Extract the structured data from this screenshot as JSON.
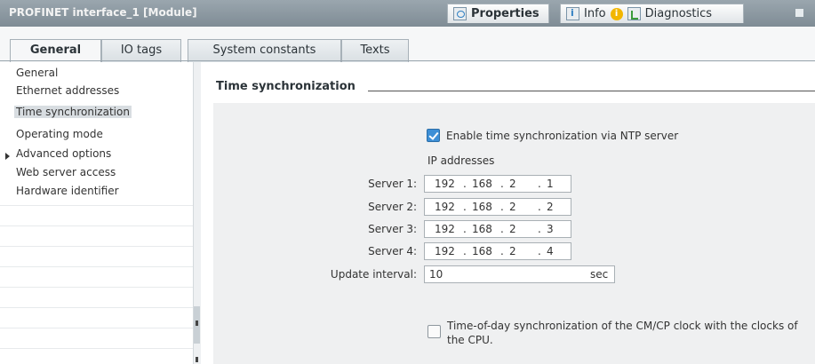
{
  "header": {
    "title": "PROFINET interface_1 [Module]",
    "tabs": [
      {
        "label": "Properties",
        "icon": "properties-icon"
      },
      {
        "label": "Info",
        "icon": "info-icon"
      },
      {
        "label": "Diagnostics",
        "icon": "diagnostics-icon"
      }
    ],
    "warning_badge": "i"
  },
  "subtabs": [
    "General",
    "IO tags",
    "System constants",
    "Texts"
  ],
  "sidebar": {
    "items": [
      {
        "label": "General"
      },
      {
        "label": "Ethernet addresses"
      },
      {
        "label": "Time synchronization",
        "selected": true
      },
      {
        "label": "Operating mode"
      },
      {
        "label": "Advanced options",
        "expandable": true
      },
      {
        "label": "Web server access"
      },
      {
        "label": "Hardware identifier"
      }
    ]
  },
  "main": {
    "section_title": "Time synchronization",
    "enable_ntp": {
      "label": "Enable time synchronization via NTP server",
      "checked": true
    },
    "ip_heading": "IP addresses",
    "servers": [
      {
        "label": "Server 1:",
        "octets": [
          "192",
          "168",
          "2",
          "1"
        ]
      },
      {
        "label": "Server 2:",
        "octets": [
          "192",
          "168",
          "2",
          "2"
        ]
      },
      {
        "label": "Server 3:",
        "octets": [
          "192",
          "168",
          "2",
          "3"
        ]
      },
      {
        "label": "Server 4:",
        "octets": [
          "192",
          "168",
          "2",
          "4"
        ]
      }
    ],
    "update_interval": {
      "label": "Update interval:",
      "value": "10",
      "unit": "sec"
    },
    "tod_sync": {
      "label_line1": "Time-of-day synchronization of the CM/CP clock with the clocks of",
      "label_line2": "the CPU.",
      "checked": false
    }
  },
  "colors": {
    "title_bar": "#8a969e",
    "checkbox_checked": "#3d8fd6",
    "content_background": "#eff0f1"
  }
}
